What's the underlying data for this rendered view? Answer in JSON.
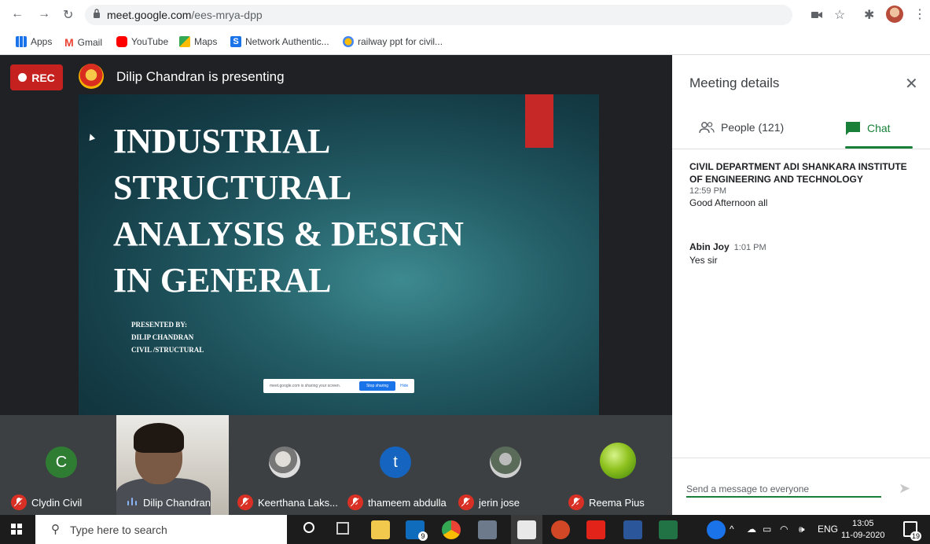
{
  "browser": {
    "url_host": "meet.google.com",
    "url_path": "/ees-mrya-dpp"
  },
  "bookmarks": [
    {
      "label": "Apps",
      "color": "#1a73e8"
    },
    {
      "label": "Gmail",
      "color": "#ea4335"
    },
    {
      "label": "YouTube",
      "color": "#ff0000"
    },
    {
      "label": "Maps",
      "color": "#34a853"
    },
    {
      "label": "Network Authentic...",
      "color": "#1a73e8"
    },
    {
      "label": "railway ppt for civil...",
      "color": "#fbbc04"
    }
  ],
  "meeting": {
    "rec_label": "REC",
    "presenting_text": "Dilip Chandran is presenting",
    "slide": {
      "title_lines": [
        "INDUSTRIAL",
        "STRUCTURAL",
        "ANALYSIS & DESIGN",
        "IN GENERAL"
      ],
      "footer_lines": [
        "PRESENTED BY:",
        "DILIP CHANDRAN",
        "CIVIL /STRUCTURAL"
      ]
    },
    "share_bar": {
      "text": "meet.google.com is sharing your screen.",
      "stop_label": "Stop sharing",
      "hide_label": "Hide"
    },
    "participants": [
      {
        "name": "Clydin Civil",
        "initial": "C",
        "muted": true
      },
      {
        "name": "Dilip Chandran",
        "muted": false
      },
      {
        "name": "Keerthana Laks...",
        "muted": true
      },
      {
        "name": "thameem abdulla",
        "initial": "t",
        "muted": true
      },
      {
        "name": "jerin jose",
        "muted": true
      },
      {
        "name": "Reema Pius",
        "muted": true
      }
    ]
  },
  "panel": {
    "title": "Meeting details",
    "tabs": {
      "people": "People (121)",
      "chat": "Chat"
    },
    "messages": [
      {
        "sender": "CIVIL DEPARTMENT ADI SHANKARA INSTITUTE OF ENGINEERING AND TECHNOLOGY",
        "time": "12:59 PM",
        "text": "Good Afternoon all"
      },
      {
        "sender": "Abin Joy",
        "time": "1:01 PM",
        "text": "Yes sir"
      }
    ],
    "input_placeholder": "Send a message to everyone"
  },
  "taskbar": {
    "search_placeholder": "Type here to search",
    "mail_badge": "9",
    "lang": "ENG",
    "time": "13:05",
    "date": "11-09-2020",
    "notif_count": "19"
  },
  "colors": {
    "google_green": "#188038",
    "rec_red": "#c5221f",
    "slide_bg": "#245e67"
  }
}
